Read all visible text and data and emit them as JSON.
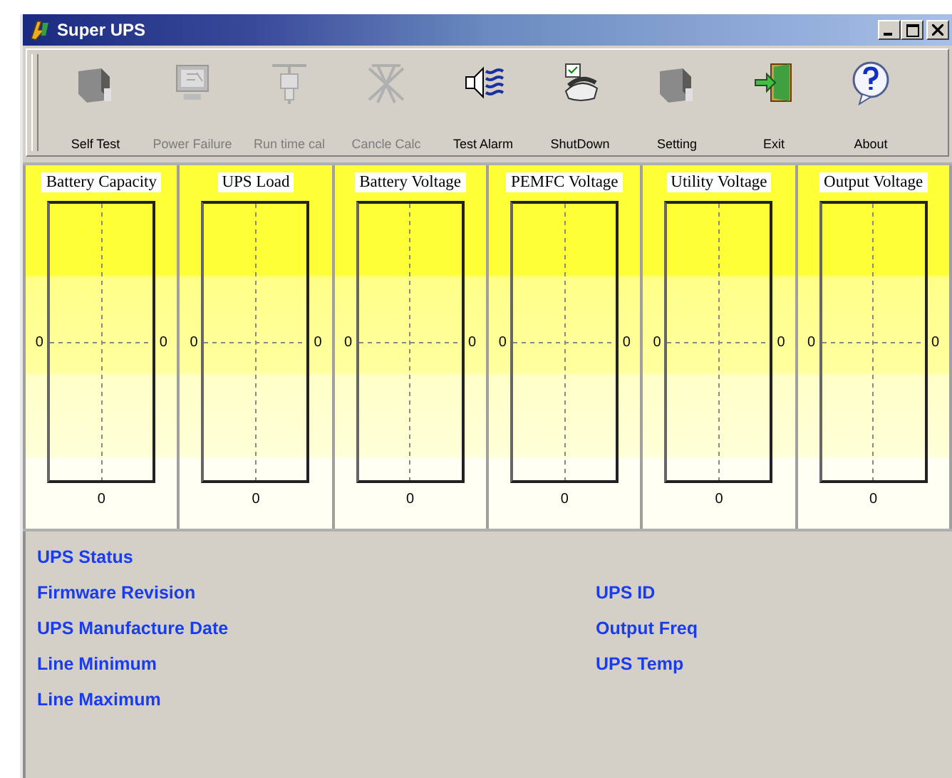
{
  "window": {
    "title": "Super UPS"
  },
  "toolbar": [
    {
      "label": "Self Test",
      "kind": "block",
      "disabled": false
    },
    {
      "label": "Power Failure",
      "kind": "monitor",
      "disabled": true
    },
    {
      "label": "Run time cal",
      "kind": "plug",
      "disabled": true
    },
    {
      "label": "Cancle Calc",
      "kind": "cross",
      "disabled": true
    },
    {
      "label": "Test Alarm",
      "kind": "speaker",
      "disabled": false
    },
    {
      "label": "ShutDown",
      "kind": "phone",
      "disabled": false
    },
    {
      "label": "Setting",
      "kind": "block",
      "disabled": false
    },
    {
      "label": "Exit",
      "kind": "door",
      "disabled": false
    },
    {
      "label": "About",
      "kind": "help",
      "disabled": false
    }
  ],
  "gauges": [
    {
      "title": "Battery Capacity",
      "left_reading": "0",
      "right_reading": "0",
      "bottom_reading": "0"
    },
    {
      "title": "UPS Load",
      "left_reading": "0",
      "right_reading": "0",
      "bottom_reading": "0"
    },
    {
      "title": "Battery Voltage",
      "left_reading": "0",
      "right_reading": "0",
      "bottom_reading": "0"
    },
    {
      "title": "PEMFC Voltage",
      "left_reading": "0",
      "right_reading": "0",
      "bottom_reading": "0"
    },
    {
      "title": "Utility Voltage",
      "left_reading": "0",
      "right_reading": "0",
      "bottom_reading": "0"
    },
    {
      "title": "Output Voltage",
      "left_reading": "0",
      "right_reading": "0",
      "bottom_reading": "0"
    }
  ],
  "status": {
    "left": [
      "UPS Status",
      "Firmware Revision",
      "UPS Manufacture Date",
      "Line Minimum",
      "Line Maximum"
    ],
    "right": [
      "UPS ID",
      "Output Freq",
      "UPS Temp"
    ]
  }
}
